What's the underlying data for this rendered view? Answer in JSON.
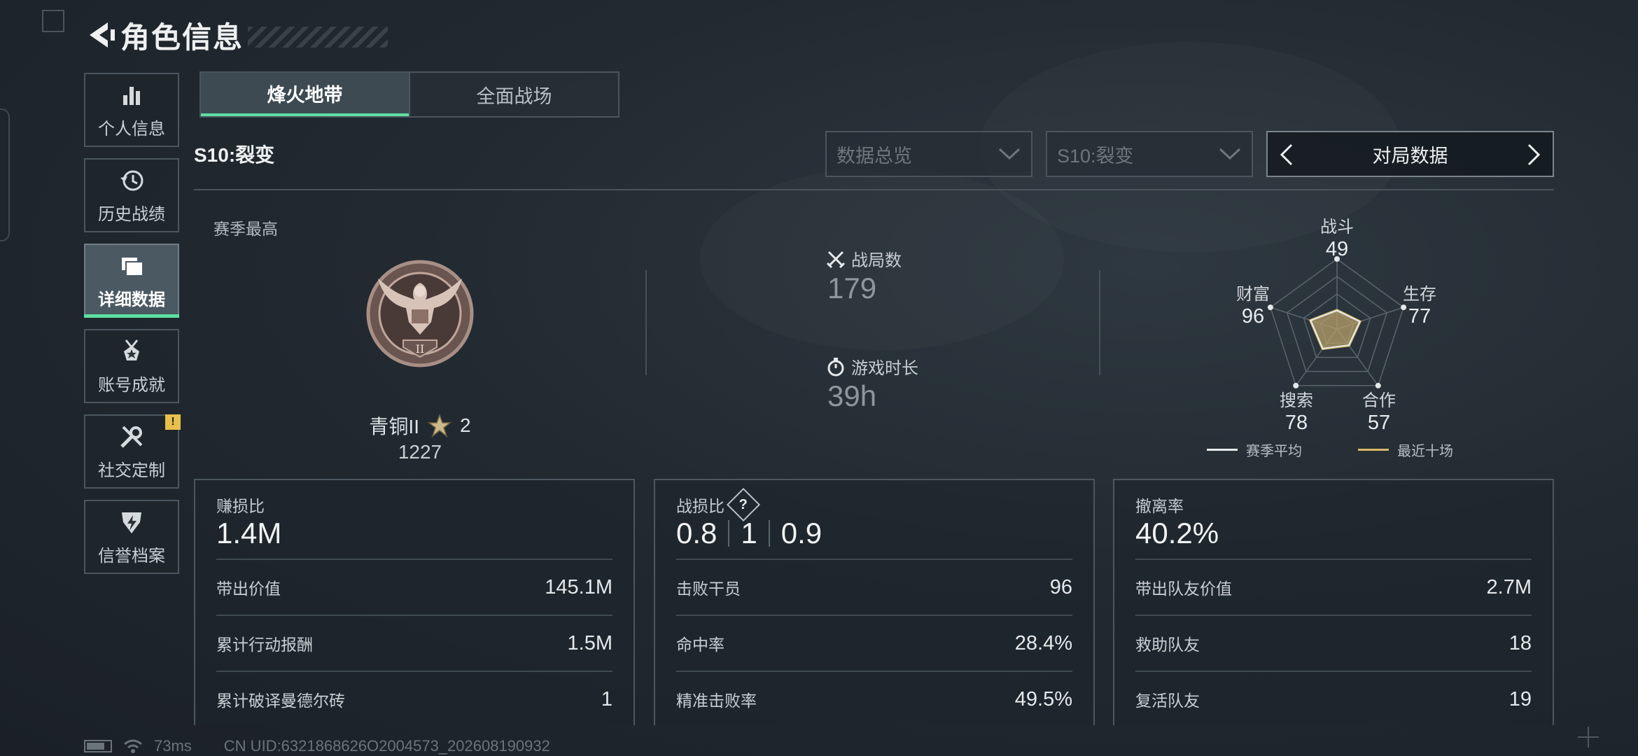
{
  "header": {
    "title": "角色信息"
  },
  "sidebar": {
    "items": [
      {
        "label": "个人信息",
        "icon": "bar-chart-icon"
      },
      {
        "label": "历史战绩",
        "icon": "history-icon"
      },
      {
        "label": "详细数据",
        "icon": "folders-icon",
        "active": true
      },
      {
        "label": "账号成就",
        "icon": "medal-icon"
      },
      {
        "label": "社交定制",
        "icon": "tools-icon",
        "badge": "!"
      },
      {
        "label": "信誉档案",
        "icon": "shield-bolt-icon"
      }
    ]
  },
  "mode_tabs": [
    {
      "label": "烽火地带",
      "active": true
    },
    {
      "label": "全面战场"
    }
  ],
  "season_title": "S10:裂变",
  "filters": {
    "dropdown1": "数据总览",
    "dropdown2": "S10:裂变",
    "pager_label": "对局数据"
  },
  "season_best": {
    "label": "赛季最高",
    "rank_name": "青铜II",
    "stars": "2",
    "score": "1227",
    "emblem_numeral": "II"
  },
  "overview": {
    "matches_label": "战局数",
    "matches_value": "179",
    "playtime_label": "游戏时长",
    "playtime_value": "39h"
  },
  "radar": {
    "axes": [
      {
        "label": "战斗",
        "value": "49"
      },
      {
        "label": "生存",
        "value": "77"
      },
      {
        "label": "合作",
        "value": "57"
      },
      {
        "label": "搜索",
        "value": "78"
      },
      {
        "label": "财富",
        "value": "96"
      }
    ],
    "legend": [
      {
        "label": "赛季平均",
        "color": "#e6e9eb"
      },
      {
        "label": "最近十场",
        "color": "#d8b866"
      }
    ]
  },
  "panels": {
    "profit": {
      "title": "赚损比",
      "value": "1.4M",
      "rows": [
        {
          "label": "带出价值",
          "value": "145.1M"
        },
        {
          "label": "累计行动报酬",
          "value": "1.5M"
        },
        {
          "label": "累计破译曼德尔砖",
          "value": "1"
        }
      ]
    },
    "kd": {
      "title": "战损比",
      "values": [
        "0.8",
        "1",
        "0.9"
      ],
      "rows": [
        {
          "label": "击败干员",
          "value": "96"
        },
        {
          "label": "命中率",
          "value": "28.4%"
        },
        {
          "label": "精准击败率",
          "value": "49.5%"
        }
      ]
    },
    "extract": {
      "title": "撤离率",
      "value": "40.2%",
      "rows": [
        {
          "label": "带出队友价值",
          "value": "2.7M"
        },
        {
          "label": "救助队友",
          "value": "18"
        },
        {
          "label": "复活队友",
          "value": "19"
        }
      ]
    }
  },
  "footer": {
    "ping": "73ms",
    "uid": "CN UID:6321868626O2004573_202608190932"
  }
}
